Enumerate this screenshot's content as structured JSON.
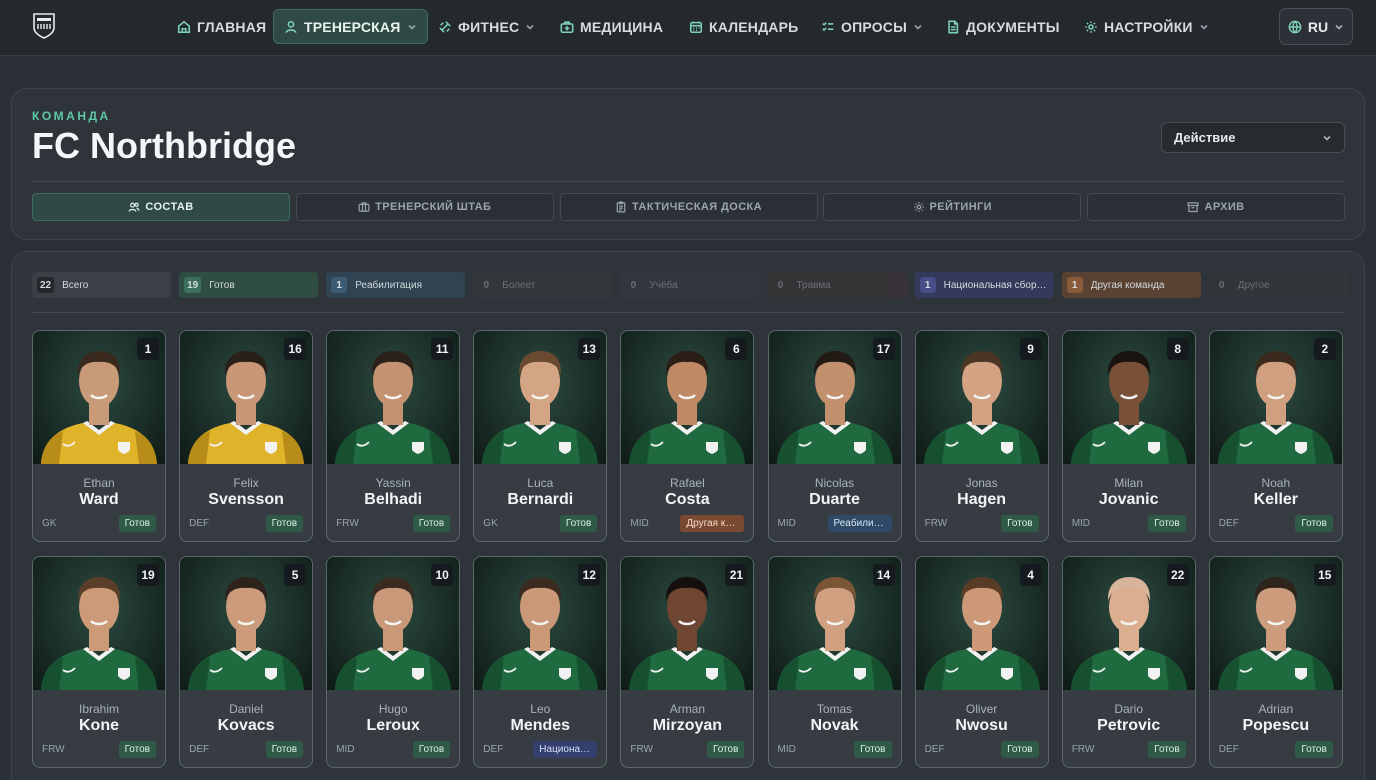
{
  "nav": {
    "items": [
      {
        "label": "ГЛАВНАЯ",
        "icon": "home-icon",
        "dropdown": false,
        "active": false
      },
      {
        "label": "ТРЕНЕРСКАЯ",
        "icon": "user-icon",
        "dropdown": true,
        "active": true
      },
      {
        "label": "ФИТНЕС",
        "icon": "dumbbell-icon",
        "dropdown": true,
        "active": false
      },
      {
        "label": "МЕДИЦИНА",
        "icon": "medkit-icon",
        "dropdown": false,
        "active": false
      },
      {
        "label": "КАЛЕНДАРЬ",
        "icon": "calendar-icon",
        "dropdown": false,
        "active": false
      },
      {
        "label": "ОПРОСЫ",
        "icon": "checklist-icon",
        "dropdown": true,
        "active": false
      },
      {
        "label": "ДОКУМЕНТЫ",
        "icon": "document-icon",
        "dropdown": false,
        "active": false
      },
      {
        "label": "НАСТРОЙКИ",
        "icon": "gear-icon",
        "dropdown": true,
        "active": false
      }
    ],
    "language": "RU"
  },
  "team": {
    "label": "КОМАНДА",
    "name": "FC Northbridge",
    "action_label": "Действие"
  },
  "tabs": [
    {
      "label": "СОСТАВ",
      "icon": "users-icon",
      "active": true
    },
    {
      "label": "ТРЕНЕРСКИЙ ШТАБ",
      "icon": "briefcase-icon",
      "active": false
    },
    {
      "label": "ТАКТИЧЕСКАЯ ДОСКА",
      "icon": "clipboard-icon",
      "active": false
    },
    {
      "label": "РЕЙТИНГИ",
      "icon": "gear-icon",
      "active": false
    },
    {
      "label": "АРХИВ",
      "icon": "archive-icon",
      "active": false
    }
  ],
  "filters": [
    {
      "count": "22",
      "label": "Всего",
      "bg": "#3a4046",
      "count_bg": "#23282c",
      "dim": false
    },
    {
      "count": "19",
      "label": "Готов",
      "bg": "#2f4d43",
      "count_bg": "#3c6f5d",
      "dim": false
    },
    {
      "count": "1",
      "label": "Реабилитация",
      "bg": "#2f4352",
      "count_bg": "#3b5a74",
      "dim": false
    },
    {
      "count": "0",
      "label": "Болеет",
      "bg": "#3a3f43",
      "count_bg": "#3a3f43",
      "dim": true
    },
    {
      "count": "0",
      "label": "Учёба",
      "bg": "#3a3d4a",
      "count_bg": "#3a3d4a",
      "dim": true
    },
    {
      "count": "0",
      "label": "Травма",
      "bg": "#4a3436",
      "count_bg": "#4a3436",
      "dim": true
    },
    {
      "count": "1",
      "label": "Национальная сборная",
      "bg": "#343a5a",
      "count_bg": "#454e86",
      "dim": false
    },
    {
      "count": "1",
      "label": "Другая команда",
      "bg": "#5a4233",
      "count_bg": "#8a5a3c",
      "dim": false
    },
    {
      "count": "0",
      "label": "Другое",
      "bg": "#383c40",
      "count_bg": "#383c40",
      "dim": true
    }
  ],
  "status_colors": {
    "ready": {
      "bg": "#2f5a48",
      "fg": "#d9efe5"
    },
    "rehab": {
      "bg": "#2f4a66",
      "fg": "#d6e4f2"
    },
    "national": {
      "bg": "#33406e",
      "fg": "#d9defa"
    },
    "other_team": {
      "bg": "#7a4a30",
      "fg": "#f4dccb"
    }
  },
  "players": [
    {
      "number": "1",
      "first": "Ethan",
      "last": "Ward",
      "pos": "GK",
      "status": "Готов",
      "status_key": "ready",
      "kit": "yellow",
      "hair": "#3a2a1e",
      "skin": "#c99a78"
    },
    {
      "number": "16",
      "first": "Felix",
      "last": "Svensson",
      "pos": "DEF",
      "status": "Готов",
      "status_key": "ready",
      "kit": "yellow",
      "hair": "#2a2019",
      "skin": "#c99677"
    },
    {
      "number": "11",
      "first": "Yassin",
      "last": "Belhadi",
      "pos": "FRW",
      "status": "Готов",
      "status_key": "ready",
      "kit": "green",
      "hair": "#2b211a",
      "skin": "#c49270"
    },
    {
      "number": "13",
      "first": "Luca",
      "last": "Bernardi",
      "pos": "GK",
      "status": "Готов",
      "status_key": "ready",
      "kit": "green",
      "hair": "#6a4a30",
      "skin": "#d4a585"
    },
    {
      "number": "6",
      "first": "Rafael",
      "last": "Costa",
      "pos": "MID",
      "status": "Другая команда",
      "status_key": "other_team",
      "kit": "green",
      "hair": "#2a1e17",
      "skin": "#c08a66"
    },
    {
      "number": "17",
      "first": "Nicolas",
      "last": "Duarte",
      "pos": "MID",
      "status": "Реабилитация",
      "status_key": "rehab",
      "kit": "green",
      "hair": "#221a15",
      "skin": "#c3906e"
    },
    {
      "number": "9",
      "first": "Jonas",
      "last": "Hagen",
      "pos": "FRW",
      "status": "Готов",
      "status_key": "ready",
      "kit": "green",
      "hair": "#4a3424",
      "skin": "#d3a283"
    },
    {
      "number": "8",
      "first": "Milan",
      "last": "Jovanic",
      "pos": "MID",
      "status": "Готов",
      "status_key": "ready",
      "kit": "green",
      "hair": "#1a1411",
      "skin": "#7a5038"
    },
    {
      "number": "2",
      "first": "Noah",
      "last": "Keller",
      "pos": "DEF",
      "status": "Готов",
      "status_key": "ready",
      "kit": "green",
      "hair": "#3a2a1e",
      "skin": "#cf9f80"
    },
    {
      "number": "19",
      "first": "Ibrahim",
      "last": "Kone",
      "pos": "FRW",
      "status": "Готов",
      "status_key": "ready",
      "kit": "green",
      "hair": "#5a3e28",
      "skin": "#cd9a78"
    },
    {
      "number": "5",
      "first": "Daniel",
      "last": "Kovacs",
      "pos": "DEF",
      "status": "Готов",
      "status_key": "ready",
      "kit": "green",
      "hair": "#2e231b",
      "skin": "#cc9b7b"
    },
    {
      "number": "10",
      "first": "Hugo",
      "last": "Leroux",
      "pos": "MID",
      "status": "Готов",
      "status_key": "ready",
      "kit": "green",
      "hair": "#3a2b20",
      "skin": "#c99878"
    },
    {
      "number": "12",
      "first": "Leo",
      "last": "Mendes",
      "pos": "DEF",
      "status": "Национальная сборная",
      "status_key": "national",
      "kit": "green",
      "hair": "#3b2b1f",
      "skin": "#ca9877"
    },
    {
      "number": "21",
      "first": "Arman",
      "last": "Mirzoyan",
      "pos": "FRW",
      "status": "Готов",
      "status_key": "ready",
      "kit": "green",
      "hair": "#15100d",
      "skin": "#6e4631"
    },
    {
      "number": "14",
      "first": "Tomas",
      "last": "Novak",
      "pos": "MID",
      "status": "Готов",
      "status_key": "ready",
      "kit": "green",
      "hair": "#7a5636",
      "skin": "#d0a080"
    },
    {
      "number": "4",
      "first": "Oliver",
      "last": "Nwosu",
      "pos": "DEF",
      "status": "Готов",
      "status_key": "ready",
      "kit": "green",
      "hair": "#5a3b26",
      "skin": "#cc9878"
    },
    {
      "number": "22",
      "first": "Dario",
      "last": "Petrovic",
      "pos": "FRW",
      "status": "Готов",
      "status_key": "ready",
      "kit": "green",
      "hair": "#d8b49a",
      "skin": "#dcae90"
    },
    {
      "number": "15",
      "first": "Adrian",
      "last": "Popescu",
      "pos": "DEF",
      "status": "Готов",
      "status_key": "ready",
      "kit": "green",
      "hair": "#2f241c",
      "skin": "#cd9c7c"
    }
  ]
}
